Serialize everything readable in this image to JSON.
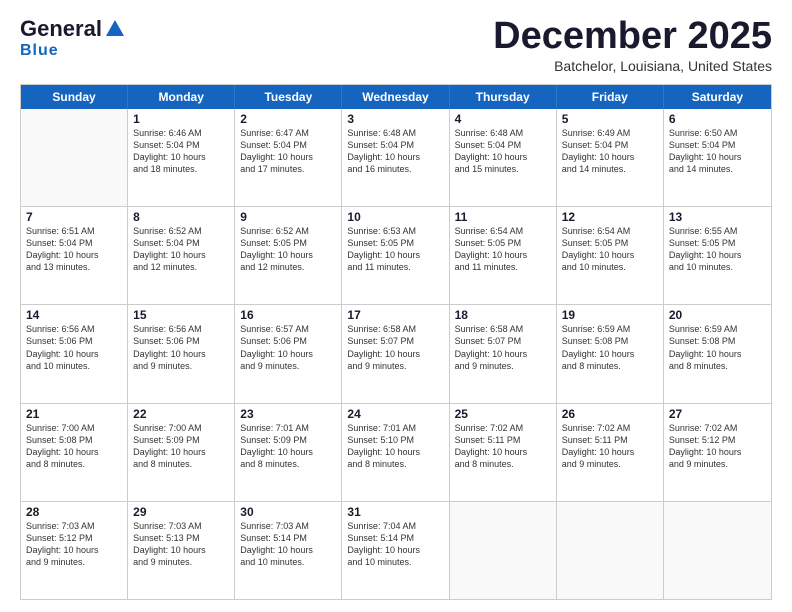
{
  "logo": {
    "line1": "General",
    "line2": "Blue"
  },
  "title": "December 2025",
  "subtitle": "Batchelor, Louisiana, United States",
  "days": [
    "Sunday",
    "Monday",
    "Tuesday",
    "Wednesday",
    "Thursday",
    "Friday",
    "Saturday"
  ],
  "weeks": [
    [
      {
        "num": "",
        "info": ""
      },
      {
        "num": "1",
        "info": "Sunrise: 6:46 AM\nSunset: 5:04 PM\nDaylight: 10 hours\nand 18 minutes."
      },
      {
        "num": "2",
        "info": "Sunrise: 6:47 AM\nSunset: 5:04 PM\nDaylight: 10 hours\nand 17 minutes."
      },
      {
        "num": "3",
        "info": "Sunrise: 6:48 AM\nSunset: 5:04 PM\nDaylight: 10 hours\nand 16 minutes."
      },
      {
        "num": "4",
        "info": "Sunrise: 6:48 AM\nSunset: 5:04 PM\nDaylight: 10 hours\nand 15 minutes."
      },
      {
        "num": "5",
        "info": "Sunrise: 6:49 AM\nSunset: 5:04 PM\nDaylight: 10 hours\nand 14 minutes."
      },
      {
        "num": "6",
        "info": "Sunrise: 6:50 AM\nSunset: 5:04 PM\nDaylight: 10 hours\nand 14 minutes."
      }
    ],
    [
      {
        "num": "7",
        "info": "Sunrise: 6:51 AM\nSunset: 5:04 PM\nDaylight: 10 hours\nand 13 minutes."
      },
      {
        "num": "8",
        "info": "Sunrise: 6:52 AM\nSunset: 5:04 PM\nDaylight: 10 hours\nand 12 minutes."
      },
      {
        "num": "9",
        "info": "Sunrise: 6:52 AM\nSunset: 5:05 PM\nDaylight: 10 hours\nand 12 minutes."
      },
      {
        "num": "10",
        "info": "Sunrise: 6:53 AM\nSunset: 5:05 PM\nDaylight: 10 hours\nand 11 minutes."
      },
      {
        "num": "11",
        "info": "Sunrise: 6:54 AM\nSunset: 5:05 PM\nDaylight: 10 hours\nand 11 minutes."
      },
      {
        "num": "12",
        "info": "Sunrise: 6:54 AM\nSunset: 5:05 PM\nDaylight: 10 hours\nand 10 minutes."
      },
      {
        "num": "13",
        "info": "Sunrise: 6:55 AM\nSunset: 5:05 PM\nDaylight: 10 hours\nand 10 minutes."
      }
    ],
    [
      {
        "num": "14",
        "info": "Sunrise: 6:56 AM\nSunset: 5:06 PM\nDaylight: 10 hours\nand 10 minutes."
      },
      {
        "num": "15",
        "info": "Sunrise: 6:56 AM\nSunset: 5:06 PM\nDaylight: 10 hours\nand 9 minutes."
      },
      {
        "num": "16",
        "info": "Sunrise: 6:57 AM\nSunset: 5:06 PM\nDaylight: 10 hours\nand 9 minutes."
      },
      {
        "num": "17",
        "info": "Sunrise: 6:58 AM\nSunset: 5:07 PM\nDaylight: 10 hours\nand 9 minutes."
      },
      {
        "num": "18",
        "info": "Sunrise: 6:58 AM\nSunset: 5:07 PM\nDaylight: 10 hours\nand 9 minutes."
      },
      {
        "num": "19",
        "info": "Sunrise: 6:59 AM\nSunset: 5:08 PM\nDaylight: 10 hours\nand 8 minutes."
      },
      {
        "num": "20",
        "info": "Sunrise: 6:59 AM\nSunset: 5:08 PM\nDaylight: 10 hours\nand 8 minutes."
      }
    ],
    [
      {
        "num": "21",
        "info": "Sunrise: 7:00 AM\nSunset: 5:08 PM\nDaylight: 10 hours\nand 8 minutes."
      },
      {
        "num": "22",
        "info": "Sunrise: 7:00 AM\nSunset: 5:09 PM\nDaylight: 10 hours\nand 8 minutes."
      },
      {
        "num": "23",
        "info": "Sunrise: 7:01 AM\nSunset: 5:09 PM\nDaylight: 10 hours\nand 8 minutes."
      },
      {
        "num": "24",
        "info": "Sunrise: 7:01 AM\nSunset: 5:10 PM\nDaylight: 10 hours\nand 8 minutes."
      },
      {
        "num": "25",
        "info": "Sunrise: 7:02 AM\nSunset: 5:11 PM\nDaylight: 10 hours\nand 8 minutes."
      },
      {
        "num": "26",
        "info": "Sunrise: 7:02 AM\nSunset: 5:11 PM\nDaylight: 10 hours\nand 9 minutes."
      },
      {
        "num": "27",
        "info": "Sunrise: 7:02 AM\nSunset: 5:12 PM\nDaylight: 10 hours\nand 9 minutes."
      }
    ],
    [
      {
        "num": "28",
        "info": "Sunrise: 7:03 AM\nSunset: 5:12 PM\nDaylight: 10 hours\nand 9 minutes."
      },
      {
        "num": "29",
        "info": "Sunrise: 7:03 AM\nSunset: 5:13 PM\nDaylight: 10 hours\nand 9 minutes."
      },
      {
        "num": "30",
        "info": "Sunrise: 7:03 AM\nSunset: 5:14 PM\nDaylight: 10 hours\nand 10 minutes."
      },
      {
        "num": "31",
        "info": "Sunrise: 7:04 AM\nSunset: 5:14 PM\nDaylight: 10 hours\nand 10 minutes."
      },
      {
        "num": "",
        "info": ""
      },
      {
        "num": "",
        "info": ""
      },
      {
        "num": "",
        "info": ""
      }
    ]
  ]
}
